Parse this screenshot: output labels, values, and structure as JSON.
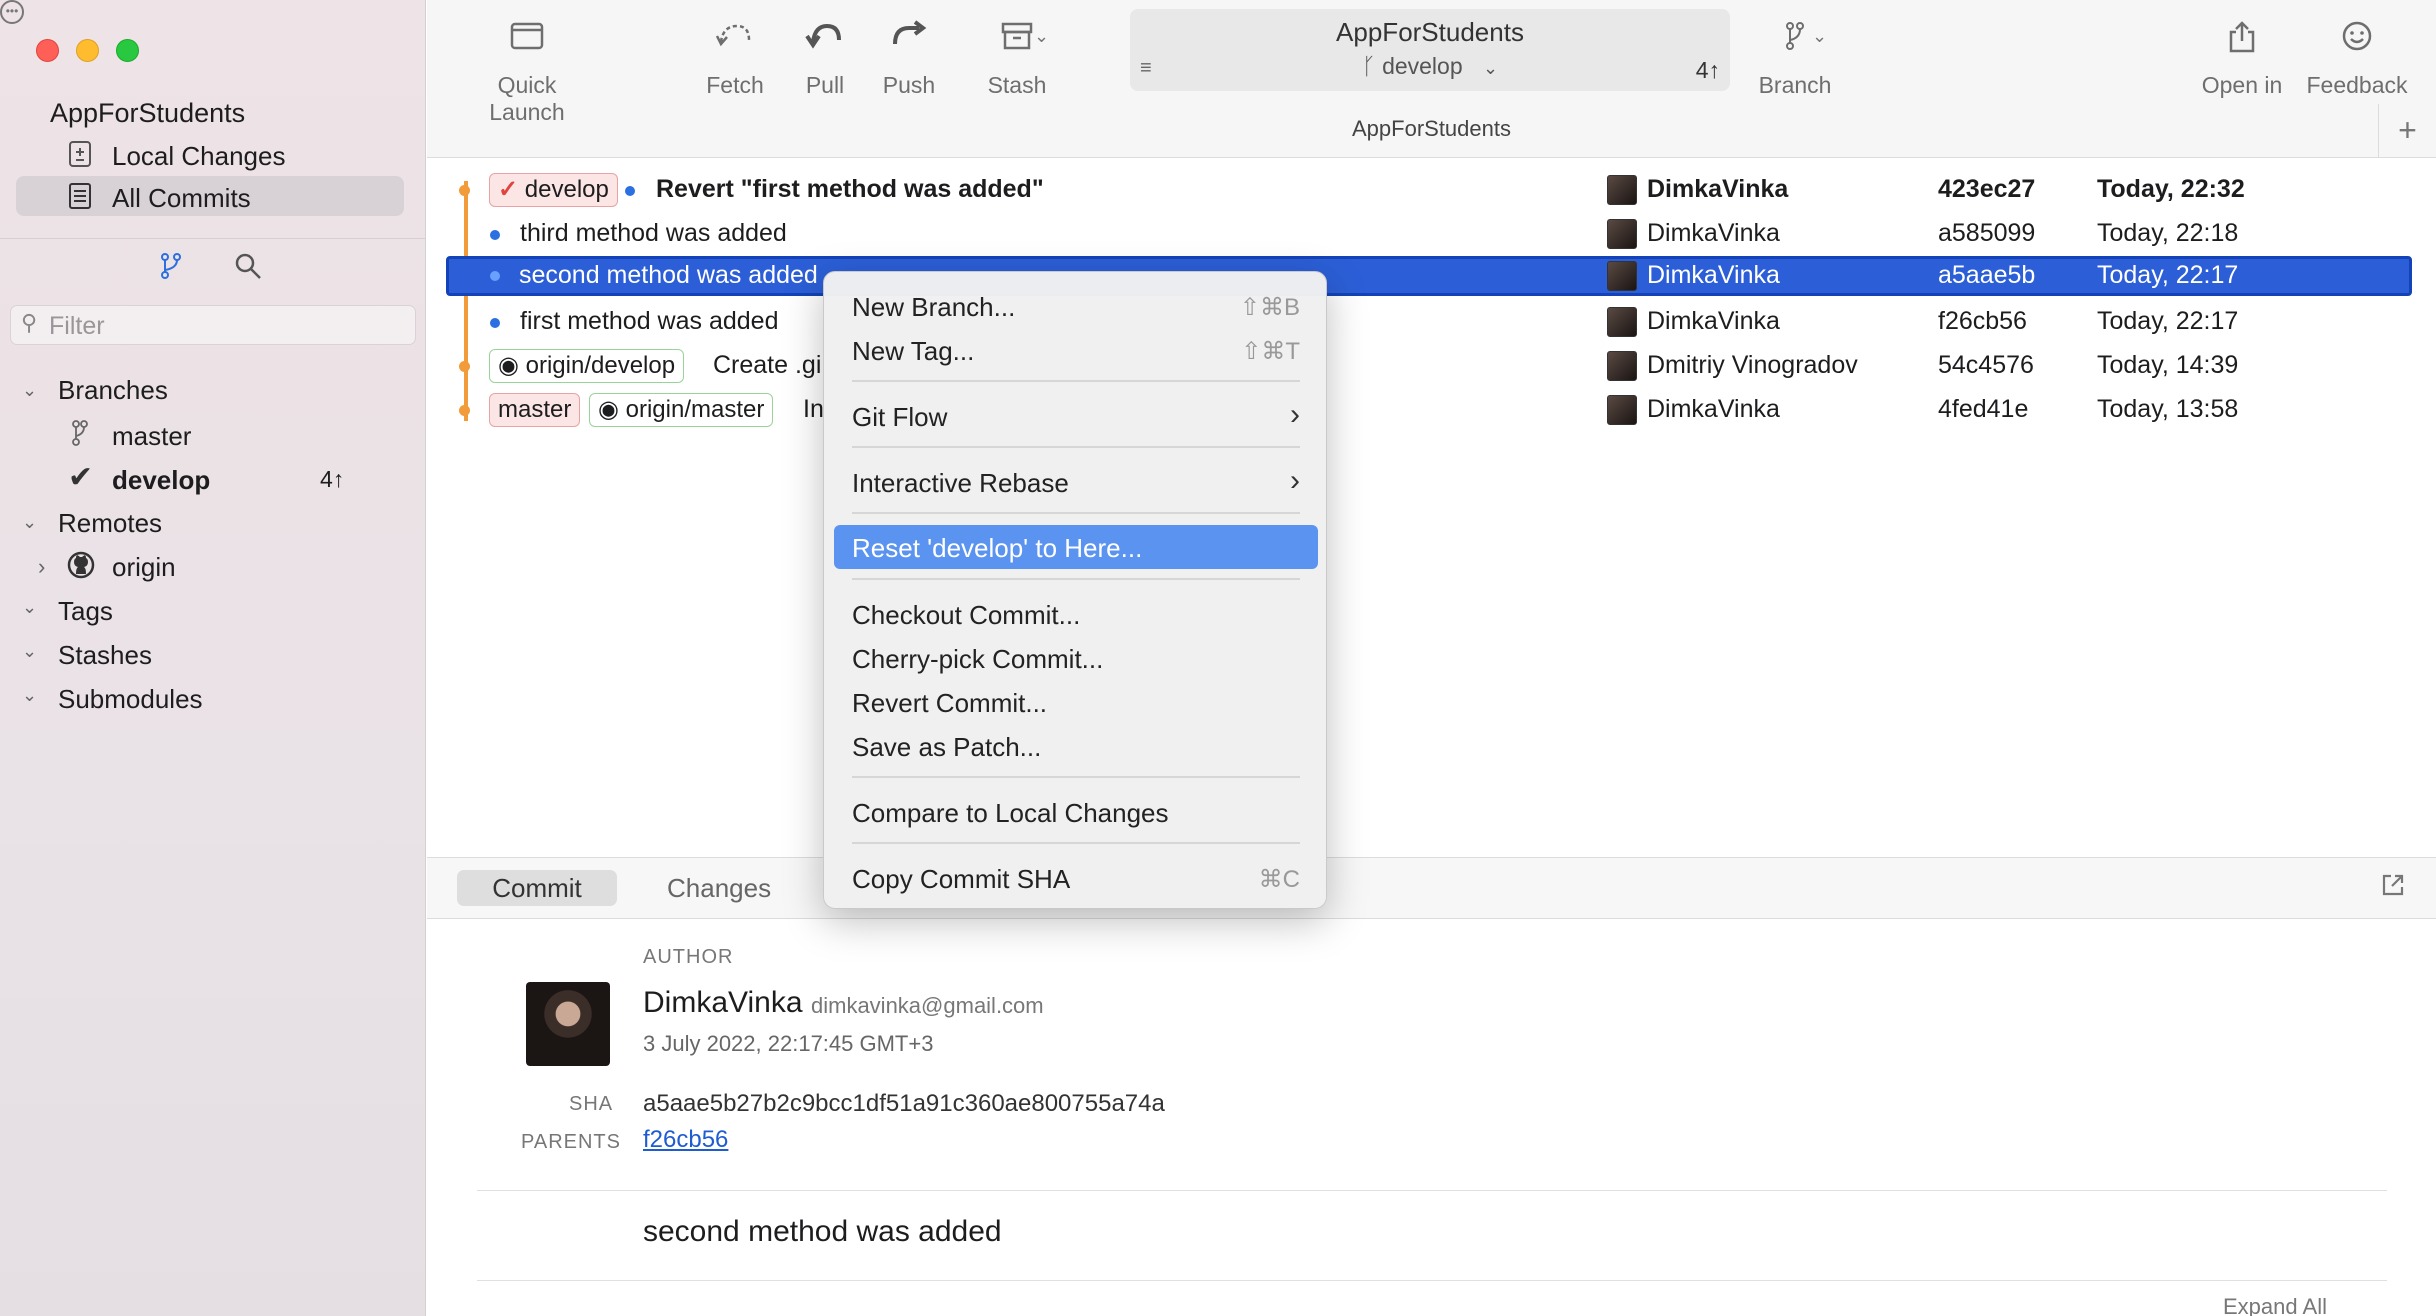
{
  "sidebar": {
    "repo_name": "AppForStudents",
    "nav": [
      {
        "label": "Local Changes"
      },
      {
        "label": "All Commits"
      }
    ],
    "filter_placeholder": "Filter",
    "sections": {
      "branches": "Branches",
      "remotes": "Remotes",
      "tags": "Tags",
      "stashes": "Stashes",
      "submodules": "Submodules"
    },
    "branches": [
      {
        "name": "master",
        "ahead": ""
      },
      {
        "name": "develop",
        "ahead": "4↑"
      }
    ],
    "remotes": [
      {
        "name": "origin"
      }
    ]
  },
  "toolbar": {
    "quick_launch": "Quick Launch",
    "fetch": "Fetch",
    "pull": "Pull",
    "push": "Push",
    "stash": "Stash",
    "repo_title": "AppForStudents",
    "branch": "develop",
    "ahead": "4↑",
    "branch_button": "Branch",
    "open_in": "Open in",
    "feedback": "Feedback",
    "tab_title": "AppForStudents"
  },
  "commits": [
    {
      "refs": [
        "develop"
      ],
      "message": "Revert \"first method was added\"",
      "author": "DimkaVinka",
      "sha": "423ec27",
      "date": "Today, 22:32"
    },
    {
      "refs": [],
      "message": "third method was added",
      "author": "DimkaVinka",
      "sha": "a585099",
      "date": "Today, 22:18"
    },
    {
      "refs": [],
      "message": "second method was added",
      "author": "DimkaVinka",
      "sha": "a5aae5b",
      "date": "Today, 22:17"
    },
    {
      "refs": [],
      "message": "first method was added",
      "author": "DimkaVinka",
      "sha": "f26cb56",
      "date": "Today, 22:17"
    },
    {
      "refs": [
        "origin/develop"
      ],
      "message": "Create .gi",
      "author": "Dmitriy Vinogradov",
      "sha": "54c4576",
      "date": "Today, 14:39"
    },
    {
      "refs": [
        "master",
        "origin/master"
      ],
      "message": "In",
      "author": "DimkaVinka",
      "sha": "4fed41e",
      "date": "Today, 13:58"
    }
  ],
  "context_menu": {
    "new_branch": {
      "label": "New Branch...",
      "shortcut": "⇧⌘B"
    },
    "new_tag": {
      "label": "New Tag...",
      "shortcut": "⇧⌘T"
    },
    "git_flow": "Git Flow",
    "interactive_rebase": "Interactive Rebase",
    "reset": "Reset 'develop' to Here...",
    "checkout": "Checkout Commit...",
    "cherry_pick": "Cherry-pick Commit...",
    "revert": "Revert Commit...",
    "save_patch": "Save as Patch...",
    "compare": "Compare to Local Changes",
    "copy_sha": {
      "label": "Copy Commit SHA",
      "shortcut": "⌘C"
    }
  },
  "detail": {
    "tabs": {
      "commit": "Commit",
      "changes": "Changes"
    },
    "author_label": "AUTHOR",
    "author_name": "DimkaVinka",
    "author_email": "dimkavinka@gmail.com",
    "date": "3 July 2022, 22:17:45 GMT+3",
    "sha_label": "SHA",
    "sha": "a5aae5b27b2c9bcc1df51a91c360ae800755a74a",
    "parents_label": "PARENTS",
    "parent": "f26cb56",
    "message": "second method was added",
    "expand_all": "Expand All"
  },
  "colors": {
    "selection": "#2c5fd7",
    "menu_highlight": "#5b93f0",
    "graph_line": "#f29b3a",
    "graph_dot": "#2c6fe0"
  }
}
